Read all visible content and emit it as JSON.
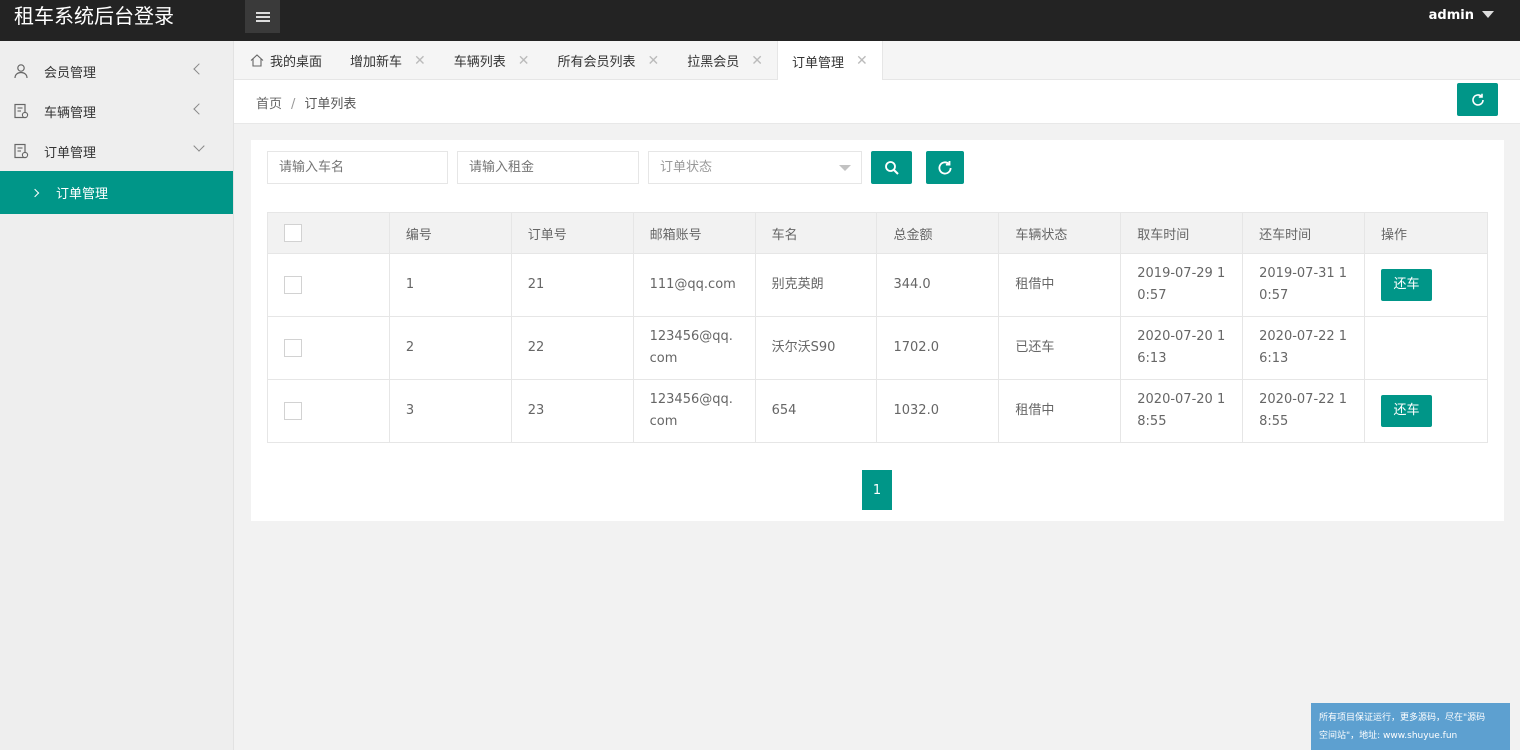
{
  "header": {
    "title": "租车系统后台登录",
    "user": "admin"
  },
  "sidebar": {
    "items": [
      {
        "label": "会员管理",
        "icon": "user-icon"
      },
      {
        "label": "车辆管理",
        "icon": "document-icon"
      },
      {
        "label": "订单管理",
        "icon": "document-icon"
      }
    ],
    "sub_item": "订单管理"
  },
  "tabs": [
    {
      "label": "我的桌面"
    },
    {
      "label": "增加新车"
    },
    {
      "label": "车辆列表"
    },
    {
      "label": "所有会员列表"
    },
    {
      "label": "拉黑会员"
    },
    {
      "label": "订单管理"
    }
  ],
  "breadcrumb": {
    "home": "首页",
    "separator": "/",
    "current": "订单列表"
  },
  "filters": {
    "car_name_placeholder": "请输入车名",
    "rent_placeholder": "请输入租金",
    "status_placeholder": "订单状态"
  },
  "table": {
    "headers": [
      "编号",
      "订单号",
      "邮箱账号",
      "车名",
      "总金额",
      "车辆状态",
      "取车时间",
      "还车时间",
      "操作"
    ],
    "rows": [
      {
        "id": "1",
        "order_no": "21",
        "email": "111@qq.com",
        "car": "别克英朗",
        "total": "344.0",
        "status": "租借中",
        "pickup": "2019-07-29 10:57",
        "return": "2019-07-31 10:57",
        "action": "还车"
      },
      {
        "id": "2",
        "order_no": "22",
        "email": "123456@qq.com",
        "car": "沃尔沃S90",
        "total": "1702.0",
        "status": "已还车",
        "pickup": "2020-07-20 16:13",
        "return": "2020-07-22 16:13",
        "action": ""
      },
      {
        "id": "3",
        "order_no": "23",
        "email": "123456@qq.com",
        "car": "654",
        "total": "1032.0",
        "status": "租借中",
        "pickup": "2020-07-20 18:55",
        "return": "2020-07-22 18:55",
        "action": "还车"
      }
    ]
  },
  "pagination": {
    "current": "1"
  },
  "watermark": {
    "line1": "所有项目保证运行，更多源码，尽在\"源码",
    "line2": "空间站\"，地址: www.shuyue.fun"
  },
  "colors": {
    "accent": "#009688",
    "header_bg": "#232323"
  }
}
